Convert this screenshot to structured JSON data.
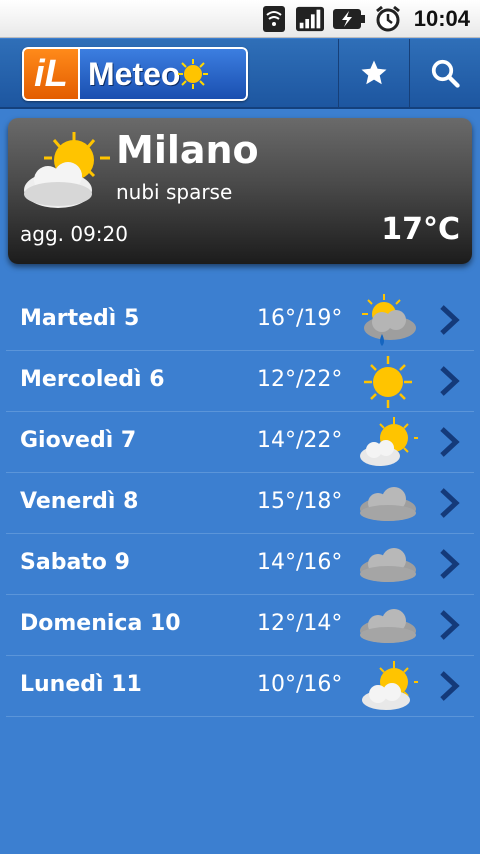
{
  "status_bar": {
    "time": "10:04"
  },
  "action_bar": {
    "logo_il": "iL",
    "logo_meteo": "Meteo",
    "star_icon": "star-icon",
    "search_icon": "search-icon"
  },
  "current": {
    "city": "Milano",
    "description": "nubi sparse",
    "updated": "agg. 09:20",
    "temperature": "17°C",
    "icon": "sun-behind-cloud-icon"
  },
  "forecast": [
    {
      "day": "Martedì 5",
      "temp": "16°/19°",
      "icon": "rain-cloud-sun"
    },
    {
      "day": "Mercoledì 6",
      "temp": "12°/22°",
      "icon": "sun"
    },
    {
      "day": "Giovedì 7",
      "temp": "14°/22°",
      "icon": "sun-cloud"
    },
    {
      "day": "Venerdì 8",
      "temp": "15°/18°",
      "icon": "cloud"
    },
    {
      "day": "Sabato 9",
      "temp": "14°/16°",
      "icon": "cloud"
    },
    {
      "day": "Domenica 10",
      "temp": "12°/14°",
      "icon": "cloud"
    },
    {
      "day": "Lunedì 11",
      "temp": "10°/16°",
      "icon": "sun-cloud"
    }
  ],
  "colors": {
    "background": "#3c7fd0",
    "action_bar": "#1d56a0",
    "sun": "#ffc400",
    "chevron": "#143a7a"
  }
}
